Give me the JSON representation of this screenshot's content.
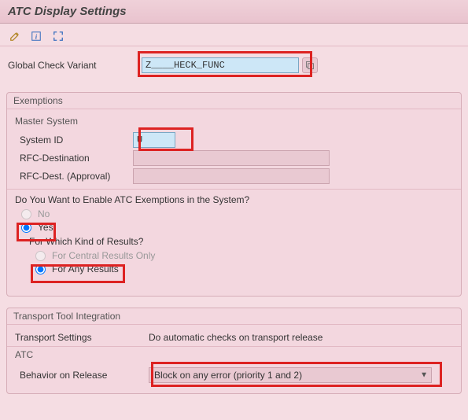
{
  "title": "ATC Display Settings",
  "toolbar": {
    "edit_icon": "pencil-icon",
    "info_icon": "info-icon",
    "expand_icon": "expand-icon"
  },
  "global_check": {
    "label": "Global Check Variant",
    "value": "Z____HECK_FUNC"
  },
  "exemptions": {
    "title": "Exemptions",
    "master_system_label": "Master System",
    "system_id_label": "System ID",
    "system_id_value": "U",
    "rfc_dest_label": "RFC-Destination",
    "rfc_dest_value": "",
    "rfc_approval_label": "RFC-Dest. (Approval)",
    "rfc_approval_value": "",
    "enable_question": "Do You Want to Enable ATC Exemptions in the System?",
    "opt_no": "No",
    "opt_yes": "Yes",
    "results_question": "For Which Kind of Results?",
    "opt_central": "For Central Results Only",
    "opt_any": "For Any Results"
  },
  "transport": {
    "title": "Transport Tool Integration",
    "settings_label": "Transport Settings",
    "settings_value": "Do automatic checks on transport release",
    "atc_label": "ATC",
    "behavior_label": "Behavior on Release",
    "behavior_value": "Block on any error (priority 1 and 2)"
  }
}
